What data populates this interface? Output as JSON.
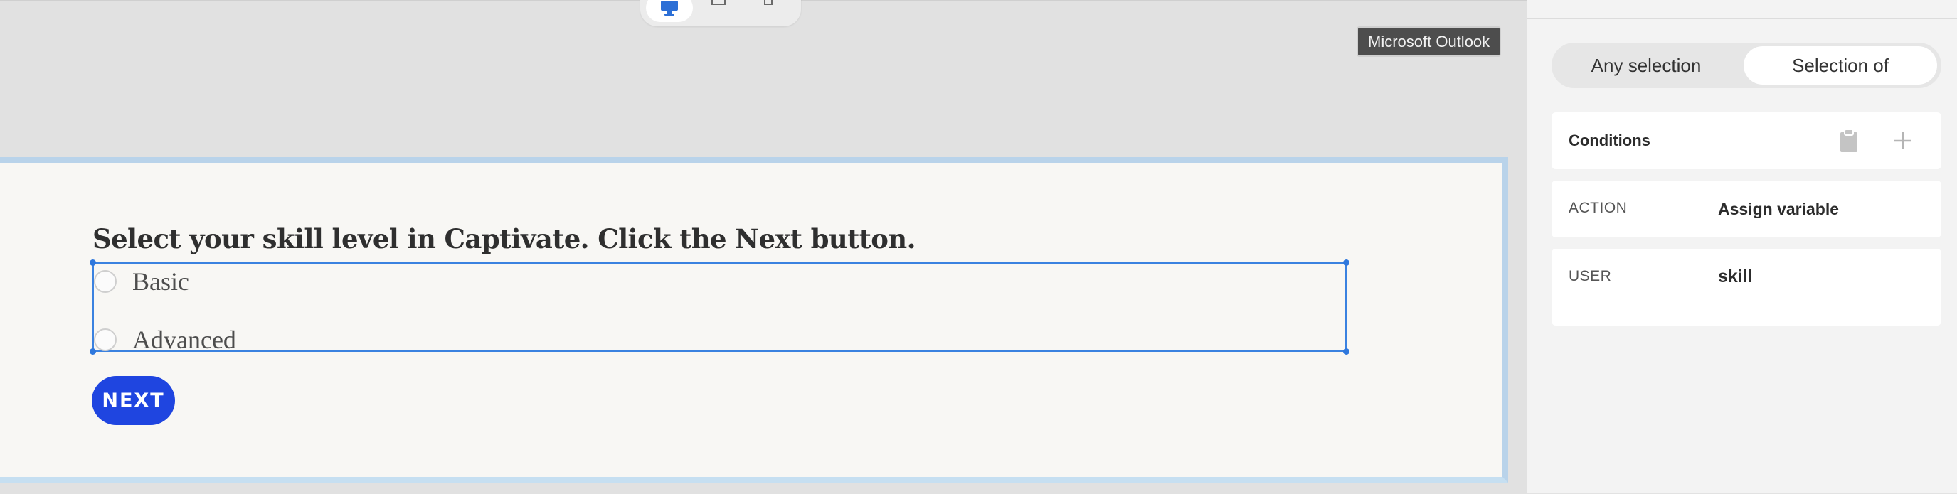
{
  "tooltip": {
    "text": "Microsoft Outlook"
  },
  "device_toggle": {
    "icons": [
      "desktop-icon",
      "tablet-icon",
      "mobile-icon"
    ],
    "active": "desktop"
  },
  "slide": {
    "question": "Select your skill level in Captivate. Click the Next button.",
    "options": [
      {
        "label": "Basic",
        "selected": false
      },
      {
        "label": "Advanced",
        "selected": false
      }
    ],
    "next_label": "NEXT"
  },
  "panel": {
    "segments": [
      {
        "label": "Any selection",
        "active": false
      },
      {
        "label": "Selection of",
        "active": true
      }
    ],
    "conditions": {
      "title": "Conditions",
      "icons": [
        "clipboard-icon",
        "plus-icon"
      ]
    },
    "action": {
      "key": "ACTION",
      "value": "Assign variable"
    },
    "user": {
      "key": "USER",
      "value": "skill"
    }
  },
  "colors": {
    "accent": "#1f45e0",
    "selection": "#3b82e0",
    "slide_border": "#b9d3ea"
  }
}
